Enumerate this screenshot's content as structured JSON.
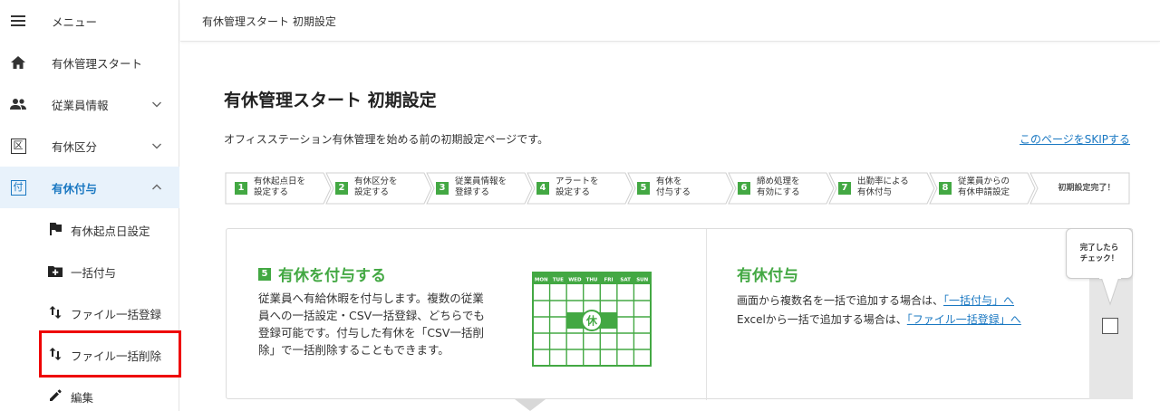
{
  "sidebar": {
    "menu_label": "メニュー",
    "items": [
      {
        "label": "有休管理スタート",
        "icon": "home-icon"
      },
      {
        "label": "従業員情報",
        "icon": "people-icon"
      },
      {
        "label": "有休区分",
        "icon": "kubun-icon"
      },
      {
        "label": "有休付与",
        "icon": "fuyo-icon"
      }
    ],
    "subitems": [
      {
        "label": "有休起点日設定",
        "icon": "flag-icon"
      },
      {
        "label": "一括付与",
        "icon": "add-box-icon"
      },
      {
        "label": "ファイル一括登録",
        "icon": "swap-vertical-icon"
      },
      {
        "label": "ファイル一括削除",
        "icon": "swap-vertical-icon"
      },
      {
        "label": "編集",
        "icon": "pencil-icon"
      }
    ],
    "kubun_glyph": "区",
    "fuyo_glyph": "付"
  },
  "header": {
    "title": "有休管理スタート 初期設定"
  },
  "main": {
    "title": "有休管理スタート 初期設定",
    "intro": "オフィスステーション有休管理を始める前の初期設定ページです。",
    "skip_link": "このページをSKIPする"
  },
  "steps": [
    {
      "num": "1",
      "text": "有休起点日を\n設定する"
    },
    {
      "num": "2",
      "text": "有休区分を\n設定する"
    },
    {
      "num": "3",
      "text": "従業員情報を\n登録する"
    },
    {
      "num": "4",
      "text": "アラートを\n設定する"
    },
    {
      "num": "5",
      "text": "有休を\n付与する"
    },
    {
      "num": "6",
      "text": "締め処理を\n有効にする"
    },
    {
      "num": "7",
      "text": "出勤率による\n有休付与"
    },
    {
      "num": "8",
      "text": "従業員からの\n有休申請設定"
    },
    {
      "num": "",
      "text": "初期設定完了！"
    }
  ],
  "card": {
    "left": {
      "num": "5",
      "heading": "有休を付与する",
      "body": "従業員へ有給休暇を付与します。複数の従業員への一括設定・CSV一括登録、どちらでも登録可能です。付与した有休を「CSV一括削除」で一括削除することもできます。"
    },
    "calendar": {
      "days": [
        "MON",
        "TUE",
        "WED",
        "THU",
        "FRI",
        "SAT",
        "SUN"
      ],
      "badge": "休",
      "color": "#43a843"
    },
    "right": {
      "heading": "有休付与",
      "line1_prefix": "画面から複数名を一括で追加する場合は、",
      "line1_link": "「一括付与」へ",
      "line2_prefix": "Excelから一括で追加する場合は、",
      "line2_link": "「ファイル一括登録」へ"
    },
    "check": {
      "line1": "完了したら",
      "line2": "チェック！"
    }
  },
  "colors": {
    "accent_green": "#43a843",
    "link_blue": "#1a78c2",
    "active_bg": "#e8f2fb",
    "highlight_red": "#e00000"
  }
}
